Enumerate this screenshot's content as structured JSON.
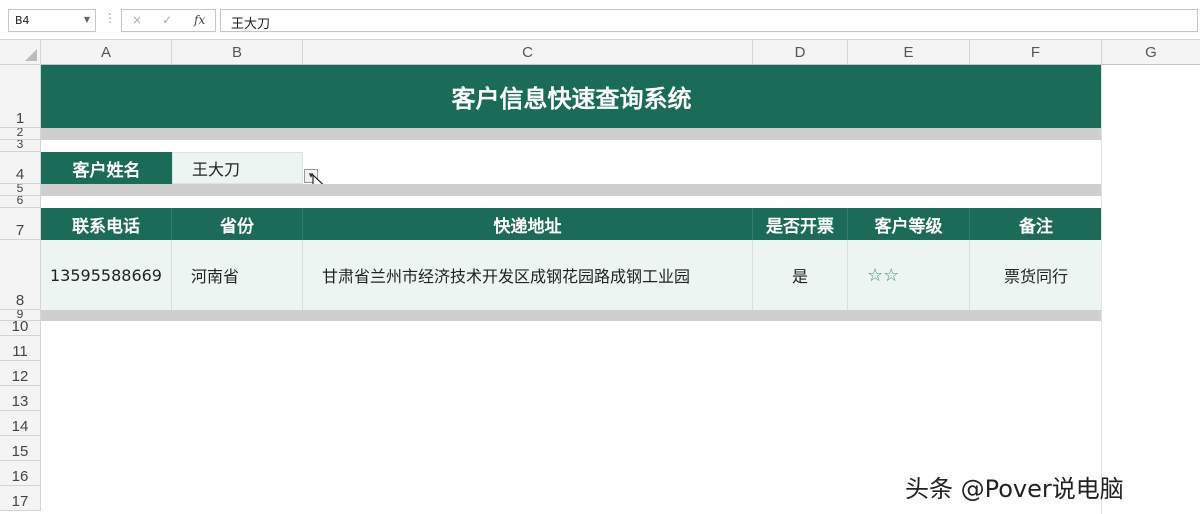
{
  "formula_bar": {
    "name_box": "B4",
    "cancel_symbol": "×",
    "enter_symbol": "✓",
    "fx_symbol": "fx",
    "formula_value": "王大刀"
  },
  "columns": [
    "A",
    "B",
    "C",
    "D",
    "E",
    "F",
    "G"
  ],
  "rows": [
    "1",
    "2",
    "3",
    "4",
    "5",
    "6",
    "7",
    "8",
    "9",
    "10",
    "11",
    "12",
    "13",
    "14",
    "15",
    "16",
    "17"
  ],
  "sheet": {
    "title": "客户信息快速查询系统",
    "lookup_label": "客户姓名",
    "lookup_value": "王大刀",
    "headers": [
      "联系电话",
      "省份",
      "快递地址",
      "是否开票",
      "客户等级",
      "备注"
    ],
    "record": [
      "13595588669",
      "河南省",
      "甘肃省兰州市经济技术开发区成钢花园路成钢工业园",
      "是",
      "☆☆",
      "票货同行"
    ]
  },
  "watermark": "头条 @Pover说电脑",
  "colors": {
    "header_green": "#1b6b59",
    "band_gray": "#cfcfcf",
    "cell_light": "#edf5f3"
  }
}
